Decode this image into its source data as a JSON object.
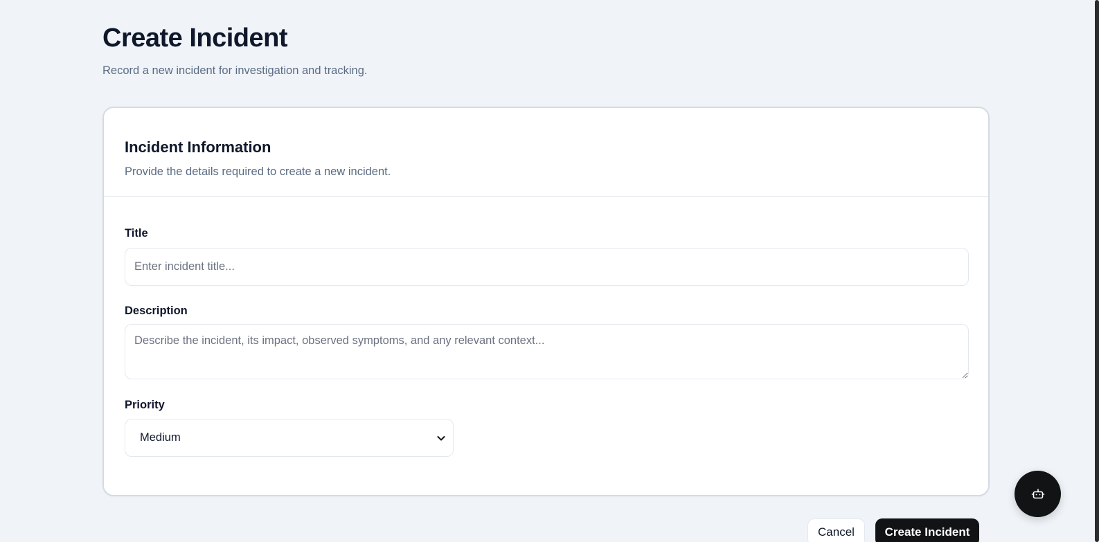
{
  "header": {
    "title": "Create Incident",
    "subtitle": "Record a new incident for investigation and tracking."
  },
  "card": {
    "title": "Incident Information",
    "description": "Provide the details required to create a new incident."
  },
  "form": {
    "title_label": "Title",
    "title_placeholder": "Enter incident title...",
    "title_value": "",
    "description_label": "Description",
    "description_placeholder": "Describe the incident, its impact, observed symptoms, and any relevant context...",
    "description_value": "",
    "priority_label": "Priority",
    "priority_selected": "Medium"
  },
  "actions": {
    "cancel_label": "Cancel",
    "submit_label": "Create Incident"
  },
  "fab": {
    "icon": "bot-icon"
  },
  "colors": {
    "background": "#f0f4f9",
    "primary": "#111315",
    "muted_text": "#5b6b82",
    "border": "#e2e8f0"
  }
}
